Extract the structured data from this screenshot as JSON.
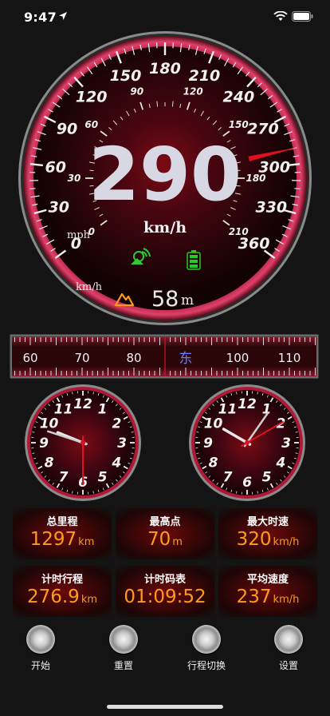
{
  "status_bar": {
    "time": "9:47"
  },
  "speedometer": {
    "speed": "290",
    "unit": "km/h",
    "outer_labels": [
      "0",
      "30",
      "60",
      "90",
      "120",
      "150",
      "180",
      "210",
      "240",
      "270",
      "300",
      "330",
      "360"
    ],
    "inner_labels": [
      "0",
      "30",
      "60",
      "90",
      "120",
      "150",
      "180",
      "210"
    ],
    "mph_label": "mph",
    "kmh_label": "km/h",
    "altitude_value": "58",
    "altitude_unit": "m",
    "needle_value_kmh": 290,
    "colors": {
      "accent": "#cc1133",
      "needle": "#e01020",
      "satellite": "#2ecc2e",
      "battery": "#22cc22",
      "mountain": "#ff9a1a"
    }
  },
  "compass": {
    "labels": [
      "60",
      "70",
      "80",
      "东",
      "100",
      "110"
    ],
    "heading_label": "东"
  },
  "clocks": {
    "left": {
      "hour_deg": 292,
      "minute_deg": 288,
      "second_deg": 180
    },
    "right": {
      "hour_deg": 300,
      "minute_deg": 35,
      "second_deg": 60
    },
    "numbers": [
      "12",
      "1",
      "2",
      "3",
      "4",
      "5",
      "6",
      "7",
      "8",
      "9",
      "10",
      "11"
    ]
  },
  "stats": [
    {
      "label": "总里程",
      "value": "1297",
      "unit": "km"
    },
    {
      "label": "最高点",
      "value": "70",
      "unit": "m"
    },
    {
      "label": "最大时速",
      "value": "320",
      "unit": "km/h"
    },
    {
      "label": "计时行程",
      "value": "276.9",
      "unit": "km"
    },
    {
      "label": "计时码表",
      "value": "01:09:52",
      "unit": ""
    },
    {
      "label": "平均速度",
      "value": "237",
      "unit": "km/h"
    }
  ],
  "buttons": [
    {
      "label": "开始"
    },
    {
      "label": "重置"
    },
    {
      "label": "行程切换"
    },
    {
      "label": "设置"
    }
  ]
}
